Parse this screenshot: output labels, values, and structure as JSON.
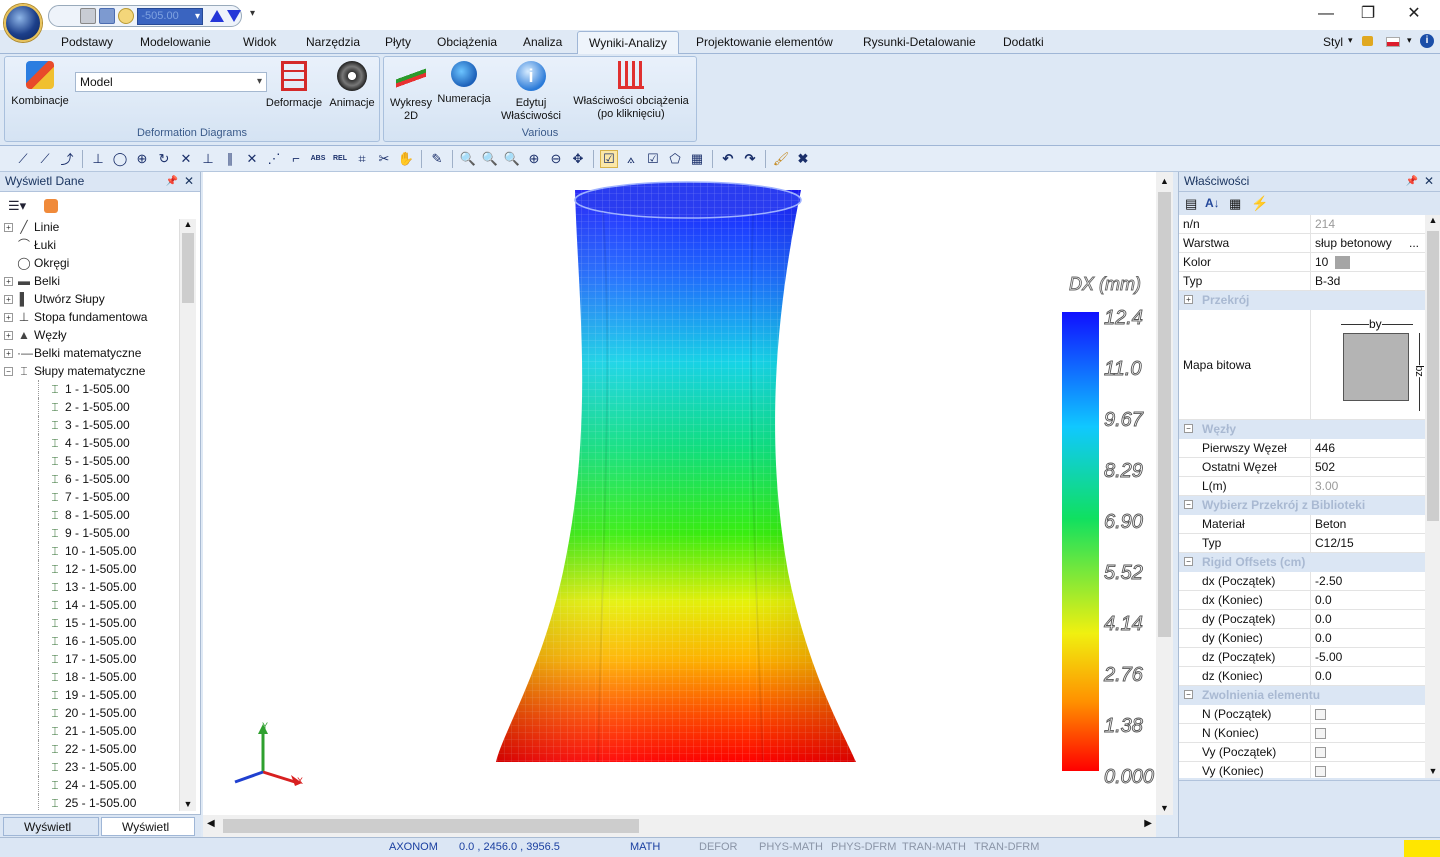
{
  "titlebar": {
    "level_value": "-505.00",
    "min": "—",
    "restore": "❐",
    "close": "✕"
  },
  "menu": {
    "tabs": [
      "Podstawy",
      "Modelowanie",
      "Widok",
      "Narzędzia",
      "Płyty",
      "Obciążenia",
      "Analiza",
      "Wyniki-Analizy",
      "Projektowanie elementów",
      "Rysunki-Detalowanie",
      "Dodatki"
    ],
    "active": "Wyniki-Analizy",
    "style_label": "Styl"
  },
  "ribbon": {
    "kombinacje": "Kombinacje",
    "model_combo": "Model",
    "deformacje": "Deformacje",
    "animacje": "Animacje",
    "group1": "Deformation Diagrams",
    "wykresy_l1": "Wykresy",
    "wykresy_l2": "2D",
    "numeracja": "Numeracja",
    "edytuj_l1": "Edytuj",
    "edytuj_l2": "Właściwości",
    "wlasc_l1": "Właściwości obciążenia",
    "wlasc_l2": "(po kliknięciu)",
    "group2": "Various"
  },
  "left_panel": {
    "title": "Wyświetl Dane",
    "tree": [
      {
        "label": "Linie",
        "icon": "line-icon"
      },
      {
        "label": "Łuki",
        "icon": "arc-icon"
      },
      {
        "label": "Okręgi",
        "icon": "circle-icon"
      },
      {
        "label": "Belki",
        "icon": "beam-icon"
      },
      {
        "label": "Utwórz Słupy",
        "icon": "column-icon"
      },
      {
        "label": "Stopa fundamentowa",
        "icon": "footing-icon"
      },
      {
        "label": "Węzły",
        "icon": "node-icon"
      },
      {
        "label": "Belki matematyczne",
        "icon": "math-beam-icon"
      },
      {
        "label": "Słupy matematyczne",
        "icon": "math-column-icon"
      }
    ],
    "children": [
      "1 - 1-505.00",
      "2 - 1-505.00",
      "3 - 1-505.00",
      "4 - 1-505.00",
      "5 - 1-505.00",
      "6 - 1-505.00",
      "7 - 1-505.00",
      "8 - 1-505.00",
      "9 - 1-505.00",
      "10 - 1-505.00",
      "12 - 1-505.00",
      "13 - 1-505.00",
      "14 - 1-505.00",
      "15 - 1-505.00",
      "16 - 1-505.00",
      "17 - 1-505.00",
      "18 - 1-505.00",
      "19 - 1-505.00",
      "20 - 1-505.00",
      "21 - 1-505.00",
      "22 - 1-505.00",
      "23 - 1-505.00",
      "24 - 1-505.00",
      "25 - 1-505.00"
    ],
    "tab1": "Wyświetl Par...",
    "tab2": "Wyświetl Da..."
  },
  "viewport": {
    "legend_title": "DX (mm)",
    "legend_values": [
      "12.4",
      "11.0",
      "9.67",
      "8.29",
      "6.90",
      "5.52",
      "4.14",
      "2.76",
      "1.38",
      "0.000"
    ],
    "axis_x": "X",
    "axis_y": "Y"
  },
  "right_panel": {
    "title": "Właściwości",
    "rows": [
      {
        "k": "n/n",
        "v": "214",
        "gray": true
      },
      {
        "k": "Warstwa",
        "v": "słup betonowy",
        "extra": "..."
      },
      {
        "k": "Kolor",
        "v": "10"
      },
      {
        "k": "Typ",
        "v": "B-3d"
      }
    ],
    "cat_przekroj": "Przekrój",
    "mapa_bitowa": "Mapa bitowa",
    "dim_by": "by",
    "dim_bz": "bz",
    "cat_wezly": "Węzły",
    "wezly_rows": [
      {
        "k": "Pierwszy Węzeł",
        "v": "446"
      },
      {
        "k": "Ostatni Węzeł",
        "v": "502"
      },
      {
        "k": "L(m)",
        "v": "3.00",
        "gray": true
      }
    ],
    "cat_biblioteka": "Wybierz Przekrój z Biblioteki",
    "bib_rows": [
      {
        "k": "Materiał",
        "v": "Beton"
      },
      {
        "k": "Typ",
        "v": "C12/15"
      }
    ],
    "cat_offsets": "Rigid Offsets (cm)",
    "offset_rows": [
      {
        "k": "dx (Początek)",
        "v": "-2.50"
      },
      {
        "k": "dx (Koniec)",
        "v": "0.0"
      },
      {
        "k": "dy (Początek)",
        "v": "0.0"
      },
      {
        "k": "dy (Koniec)",
        "v": "0.0"
      },
      {
        "k": "dz (Początek)",
        "v": "-5.00"
      },
      {
        "k": "dz (Koniec)",
        "v": "0.0"
      }
    ],
    "cat_zwolnienia": "Zwolnienia elementu",
    "zw_rows": [
      "N (Początek)",
      "N (Koniec)",
      "Vy (Początek)",
      "Vy (Koniec)"
    ]
  },
  "status": {
    "view": "AXONOM",
    "coords": "0.0 , 2456.0 , 3956.5",
    "modes": [
      "MATH",
      "DEFOR",
      "PHYS-MATH",
      "PHYS-DFRM",
      "TRAN-MATH",
      "TRAN-DFRM"
    ]
  }
}
